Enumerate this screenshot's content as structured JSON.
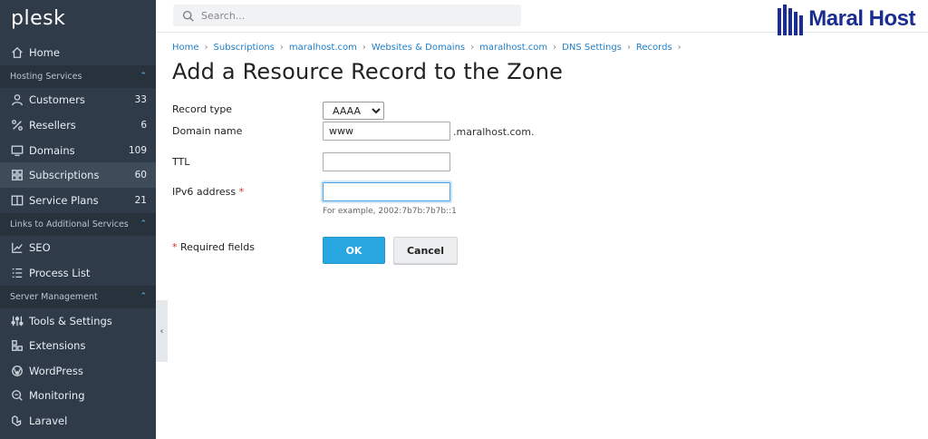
{
  "sidebar": {
    "logo": "plesk",
    "home": "Home",
    "hosting_section": "Hosting Services",
    "customers": {
      "label": "Customers",
      "count": "33"
    },
    "resellers": {
      "label": "Resellers",
      "count": "6"
    },
    "domains": {
      "label": "Domains",
      "count": "109"
    },
    "subscriptions": {
      "label": "Subscriptions",
      "count": "60"
    },
    "service_plans": {
      "label": "Service Plans",
      "count": "21"
    },
    "links_section": "Links to Additional Services",
    "seo": "SEO",
    "process_list": "Process List",
    "server_section": "Server Management",
    "tools_settings": "Tools & Settings",
    "extensions": "Extensions",
    "wordpress": "WordPress",
    "monitoring": "Monitoring",
    "laravel": "Laravel"
  },
  "topbar": {
    "search_placeholder": "Search...",
    "brand": "Maral Host"
  },
  "breadcrumb": [
    "Home",
    "Subscriptions",
    "maralhost.com",
    "Websites & Domains",
    "maralhost.com",
    "DNS Settings",
    "Records"
  ],
  "page_title": "Add a Resource Record to the Zone",
  "form": {
    "record_type_label": "Record type",
    "record_type_value": "AAAA",
    "domain_name_label": "Domain name",
    "domain_name_value": "www",
    "domain_suffix": ".maralhost.com.",
    "ttl_label": "TTL",
    "ttl_value": "",
    "ipv6_label": "IPv6 address",
    "required_star": "*",
    "ipv6_value": "",
    "ipv6_hint": "For example, 2002:7b7b:7b7b::1",
    "required_note": "Required fields",
    "ok_label": "OK",
    "cancel_label": "Cancel"
  },
  "colors": {
    "sidebar_bg": "#2f3b48",
    "accent": "#28a6e0",
    "brand": "#1b2d8f",
    "required": "#d0312d"
  }
}
